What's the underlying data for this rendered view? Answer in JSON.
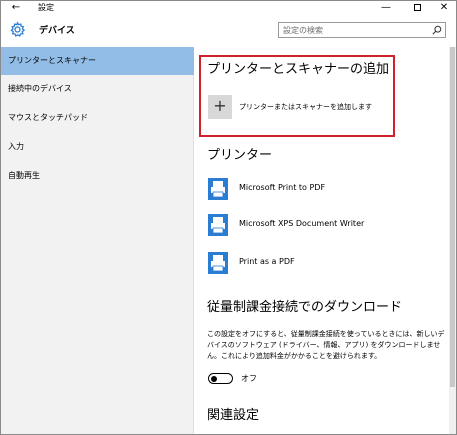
{
  "window": {
    "title": "設定",
    "back_glyph": "←",
    "minimize_glyph": "—",
    "close_glyph": "✕"
  },
  "header": {
    "section_title": "デバイス",
    "icon": "gear-icon",
    "search_placeholder": "設定の検索"
  },
  "sidebar": {
    "items": [
      {
        "label": "プリンターとスキャナー",
        "active": true
      },
      {
        "label": "接続中のデバイス",
        "active": false
      },
      {
        "label": "マウスとタッチパッド",
        "active": false
      },
      {
        "label": "入力",
        "active": false
      },
      {
        "label": "自動再生",
        "active": false
      }
    ]
  },
  "main": {
    "add_heading": "プリンターとスキャナーの追加",
    "add_button_label": "プリンターまたはスキャナーを追加します",
    "add_glyph": "+",
    "printers_heading": "プリンター",
    "printers": [
      {
        "name": "Microsoft Print to PDF"
      },
      {
        "name": "Microsoft XPS Document Writer"
      },
      {
        "name": "Print as a PDF"
      }
    ],
    "metered_heading": "従量制課金接続でのダウンロード",
    "metered_description": "この設定をオフにすると、従量制課金接続を使っているときには、新しいデバイスのソフトウェア (ドライバー、情報、アプリ) をダウンロードしません。これにより追加料金がかかることを避けられます。",
    "metered_toggle_state": "オフ",
    "related_heading": "関連設定"
  },
  "colors": {
    "accent": "#2b7cd3",
    "sidebar_active": "#92bde6",
    "highlight_border": "#d0202a"
  }
}
